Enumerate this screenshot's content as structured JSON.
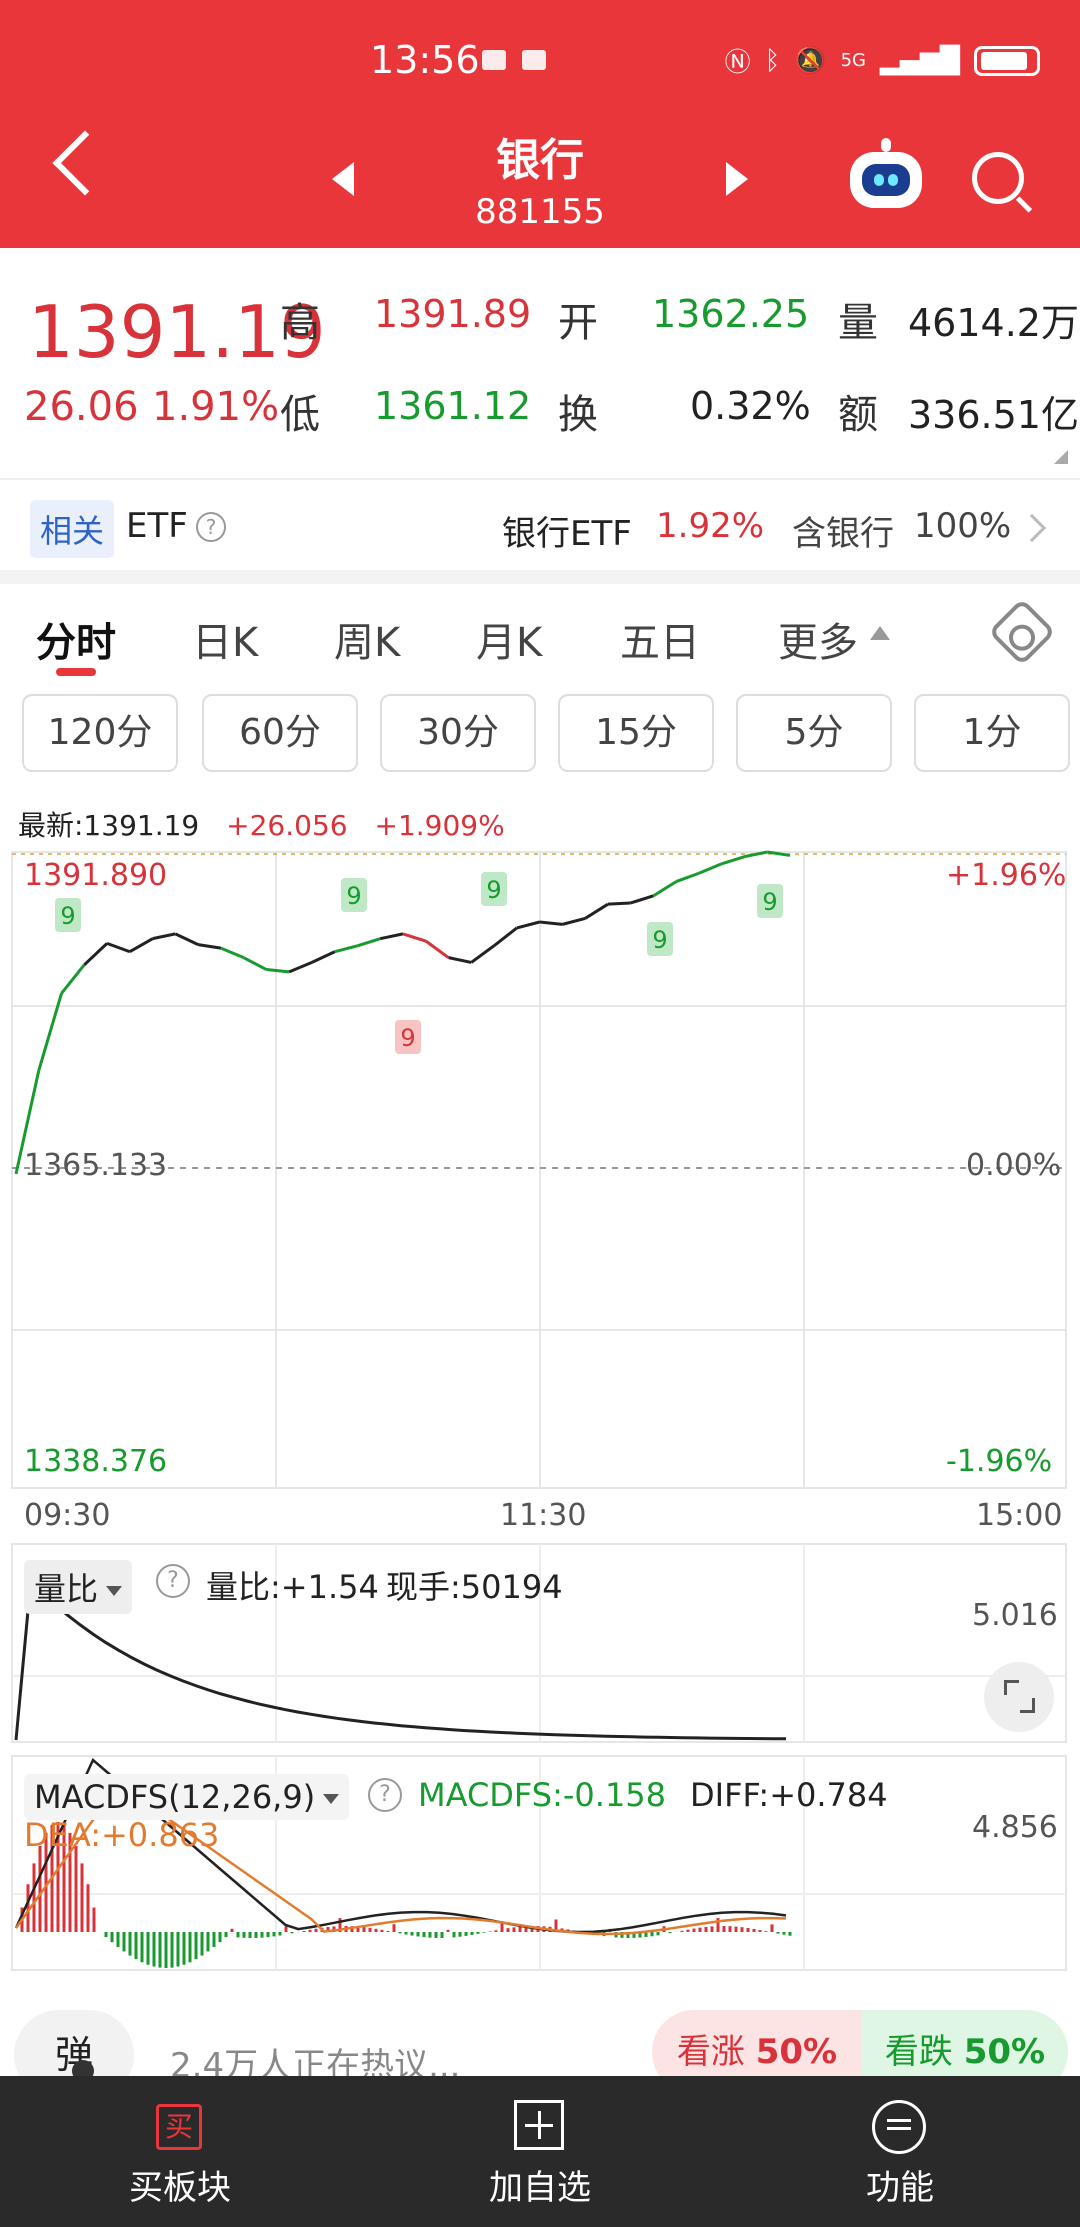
{
  "status": {
    "time": "13:56",
    "network": "5G",
    "icons": [
      "nfc-icon",
      "bluetooth-icon",
      "mute-icon",
      "signal-icon",
      "battery-icon"
    ]
  },
  "header": {
    "title": "银行",
    "code": "881155"
  },
  "quote": {
    "price": "1391.19",
    "change": "26.06",
    "change_pct": "1.91%",
    "high_label": "高",
    "high": "1391.89",
    "open_label": "开",
    "open": "1362.25",
    "volume_label": "量",
    "volume": "4614.2万",
    "low_label": "低",
    "low": "1361.12",
    "turnover_label": "换",
    "turnover": "0.32%",
    "amount_label": "额",
    "amount": "336.51亿"
  },
  "etf": {
    "tag": "相关",
    "label": "ETF",
    "name": "银行ETF",
    "pct": "1.92%",
    "hold_label": "含银行",
    "hold_pct": "100%"
  },
  "tabs": [
    "分时",
    "日K",
    "周K",
    "月K",
    "五日",
    "更多"
  ],
  "periods": [
    "120分",
    "60分",
    "30分",
    "15分",
    "5分",
    "1分"
  ],
  "chart_info": {
    "latest_label": "最新:1391.19",
    "change": "+26.056",
    "pct": "+1.909%"
  },
  "chart_data": {
    "type": "line",
    "title": "",
    "x": [
      "09:30",
      "11:30",
      "15:00"
    ],
    "y_top": "1391.890",
    "y_mid": "1365.133",
    "y_bottom": "1338.376",
    "pct_top": "+1.96%",
    "pct_mid": "0.00%",
    "pct_bottom": "-1.96%",
    "ylim": [
      1338.376,
      1391.89
    ],
    "series": [
      {
        "values": [
          1364.8,
          1373.5,
          1380.0,
          1382.4,
          1384.2,
          1383.5,
          1384.6,
          1385.0,
          1384.1,
          1383.8,
          1383.0,
          1382.0,
          1381.8,
          1382.6,
          1383.5,
          1384.0,
          1384.6,
          1385.0,
          1384.4,
          1383.0,
          1382.6,
          1384.0,
          1385.5,
          1386.0,
          1385.8,
          1386.3,
          1387.5,
          1387.6,
          1388.2,
          1389.4,
          1390.1,
          1390.9,
          1391.5,
          1391.89,
          1391.6
        ]
      }
    ],
    "nine_markers": [
      "9",
      "9",
      "9",
      "9",
      "9",
      "9"
    ]
  },
  "volume_ratio": {
    "dropdown": "量比",
    "label": "量比:+1.54",
    "hand": "现手:50194",
    "max": "5.016"
  },
  "macd": {
    "dropdown": "MACDFS(12,26,9)",
    "macdfs": "MACDFS:-0.158",
    "diff": "DIFF:+0.784",
    "dea": "DEA:+0.863",
    "max": "4.856"
  },
  "discuss": {
    "bullet": "弹",
    "text": "2.4万人正在热议...",
    "up_label": "看涨",
    "up_pct": "50%",
    "down_label": "看跌",
    "down_pct": "50%"
  },
  "bottom_nav": {
    "buy_icon": "买",
    "buy": "买板块",
    "add": "加自选",
    "fn": "功能"
  },
  "colors": {
    "red": "#e8363b",
    "green": "#179a2e"
  }
}
